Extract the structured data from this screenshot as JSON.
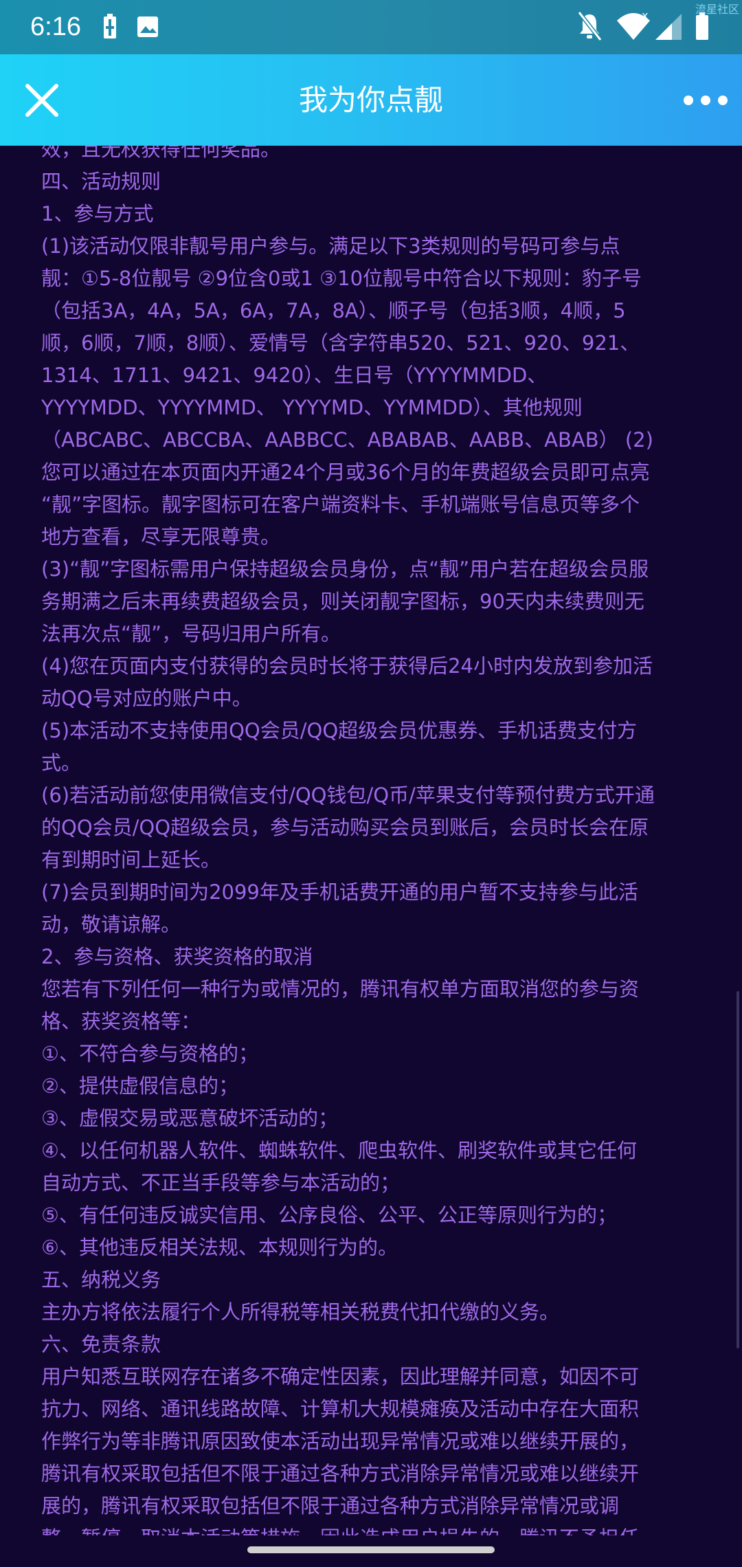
{
  "status_bar": {
    "time": "6:16",
    "watermark": "流星社区",
    "icons": [
      "battery-charging-icon",
      "gallery-icon",
      "notifications-off-icon",
      "wifi-icon",
      "cellular-signal-icon",
      "battery-icon"
    ]
  },
  "title_bar": {
    "title": "我为你点靓",
    "close_icon": "close-icon",
    "more_icon": "more-options-icon"
  },
  "colors": {
    "background": "#10062f",
    "text": "#9e69e6",
    "title_bar_start": "#1fd2f6",
    "title_bar_end": "#2e9ff0"
  },
  "content": {
    "lines": [
      "效，且无权获得任何奖品。",
      "四、活动规则",
      "1、参与方式",
      "(1)该活动仅限非靓号用户参与。满足以下3类规则的号码可参与点",
      "靓：①5-8位靓号 ②9位含0或1 ③10位靓号中符合以下规则：豹子号",
      "（包括3A，4A，5A，6A，7A，8A）、顺子号（包括3顺，4顺，5",
      "顺，6顺，7顺，8顺）、爱情号（含字符串520、521、920、921、",
      "1314、1711、9421、9420）、生日号（YYYYMMDD、",
      "YYYYMDD、YYYYMMD、 YYYYMD、YYMMDD）、其他规则",
      "（ABCABC、ABCCBA、AABBCC、ABABAB、AABB、ABAB） (2)",
      "您可以通过在本页面内开通24个月或36个月的年费超级会员即可点亮",
      "“靓”字图标。靓字图标可在客户端资料卡、手机端账号信息页等多个",
      "地方查看，尽享无限尊贵。",
      "(3)“靓”字图标需用户保持超级会员身份，点“靓”用户若在超级会员服",
      "务期满之后未再续费超级会员，则关闭靓字图标，90天内未续费则无",
      "法再次点“靓”，号码归用户所有。",
      "(4)您在页面内支付获得的会员时长将于获得后24小时内发放到参加活",
      "动QQ号对应的账户中。",
      "(5)本活动不支持使用QQ会员/QQ超级会员优惠券、手机话费支付方",
      "式。",
      "(6)若活动前您使用微信支付/QQ钱包/Q币/苹果支付等预付费方式开通",
      "的QQ会员/QQ超级会员，参与活动购买会员到账后，会员时长会在原",
      "有到期时间上延长。",
      "(7)会员到期时间为2099年及手机话费开通的用户暂不支持参与此活",
      "动，敬请谅解。",
      "2、参与资格、获奖资格的取消",
      "您若有下列任何一种行为或情况的，腾讯有权单方面取消您的参与资",
      "格、获奖资格等：",
      "①、不符合参与资格的；",
      "②、提供虚假信息的；",
      "③、虚假交易或恶意破坏活动的；",
      "④、以任何机器人软件、蜘蛛软件、爬虫软件、刷奖软件或其它任何",
      "自动方式、不正当手段等参与本活动的；",
      "⑤、有任何违反诚实信用、公序良俗、公平、公正等原则行为的；",
      "⑥、其他违反相关法规、本规则行为的。",
      "五、纳税义务",
      "主办方将依法履行个人所得税等相关税费代扣代缴的义务。",
      "六、免责条款",
      "用户知悉互联网存在诸多不确定性因素，因此理解并同意，如因不可",
      "抗力、网络、通讯线路故障、计算机大规模瘫痪及活动中存在大面积",
      "作弊行为等非腾讯原因致使本活动出现异常情况或难以继续开展的，",
      "腾讯有权采取包括但不限于通过各种方式消除异常情况或难以继续开",
      "展的，腾讯有权采取包括但不限于通过各种方式消除异常情况或调",
      "整、暂停、取消本活动等措施，因此造成用户损失的，腾讯不予担任"
    ]
  }
}
